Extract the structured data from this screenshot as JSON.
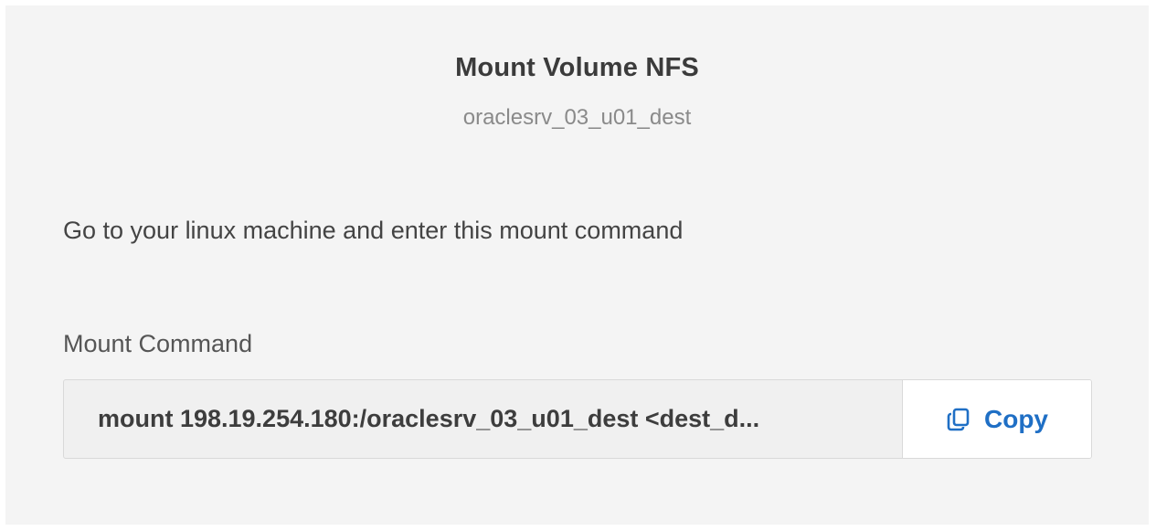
{
  "dialog": {
    "title": "Mount Volume NFS",
    "subtitle": "oraclesrv_03_u01_dest",
    "instruction": "Go to your linux machine and enter this mount command",
    "field_label": "Mount Command",
    "command_value": "mount 198.19.254.180:/oraclesrv_03_u01_dest <dest_d...",
    "copy_label": "Copy",
    "copy_icon": "copy-icon",
    "accent_color": "#1f6fc5"
  }
}
